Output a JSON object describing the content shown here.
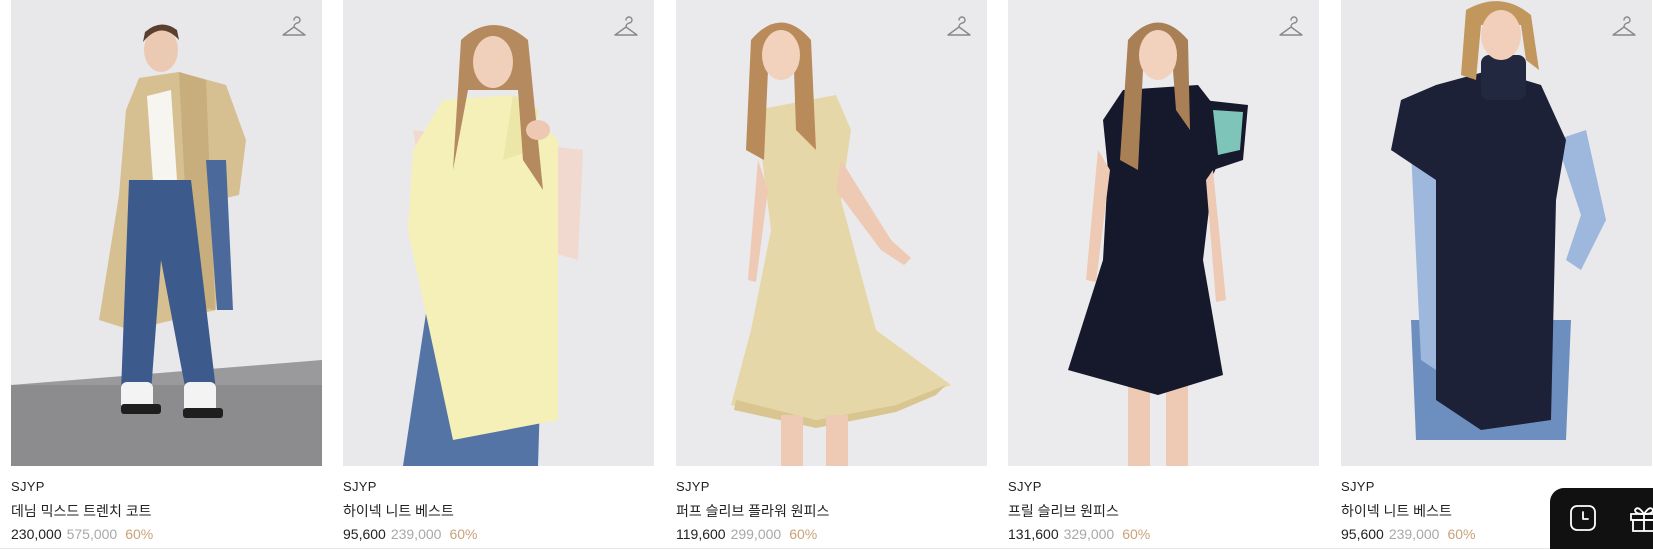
{
  "products": [
    {
      "brand": "SJYP",
      "name": "데님 믹스드 트렌치 코트",
      "price": "230,000",
      "original_price": "575,000",
      "discount": "60%"
    },
    {
      "brand": "SJYP",
      "name": "하이넥 니트 베스트",
      "price": "95,600",
      "original_price": "239,000",
      "discount": "60%"
    },
    {
      "brand": "SJYP",
      "name": "퍼프 슬리브 플라워 원피스",
      "price": "119,600",
      "original_price": "299,000",
      "discount": "60%"
    },
    {
      "brand": "SJYP",
      "name": "프릴 슬리브 원피스",
      "price": "131,600",
      "original_price": "329,000",
      "discount": "60%"
    },
    {
      "brand": "SJYP",
      "name": "하이넥 니트 베스트",
      "price": "95,600",
      "original_price": "239,000",
      "discount": "60%"
    }
  ],
  "icons": {
    "wishlist": "hanger-icon",
    "recent": "clock-icon",
    "gift": "gift-icon"
  },
  "colors": {
    "discount": "#c8a27a",
    "original_price": "#a8a8a8",
    "quick_bar": "#111111"
  }
}
